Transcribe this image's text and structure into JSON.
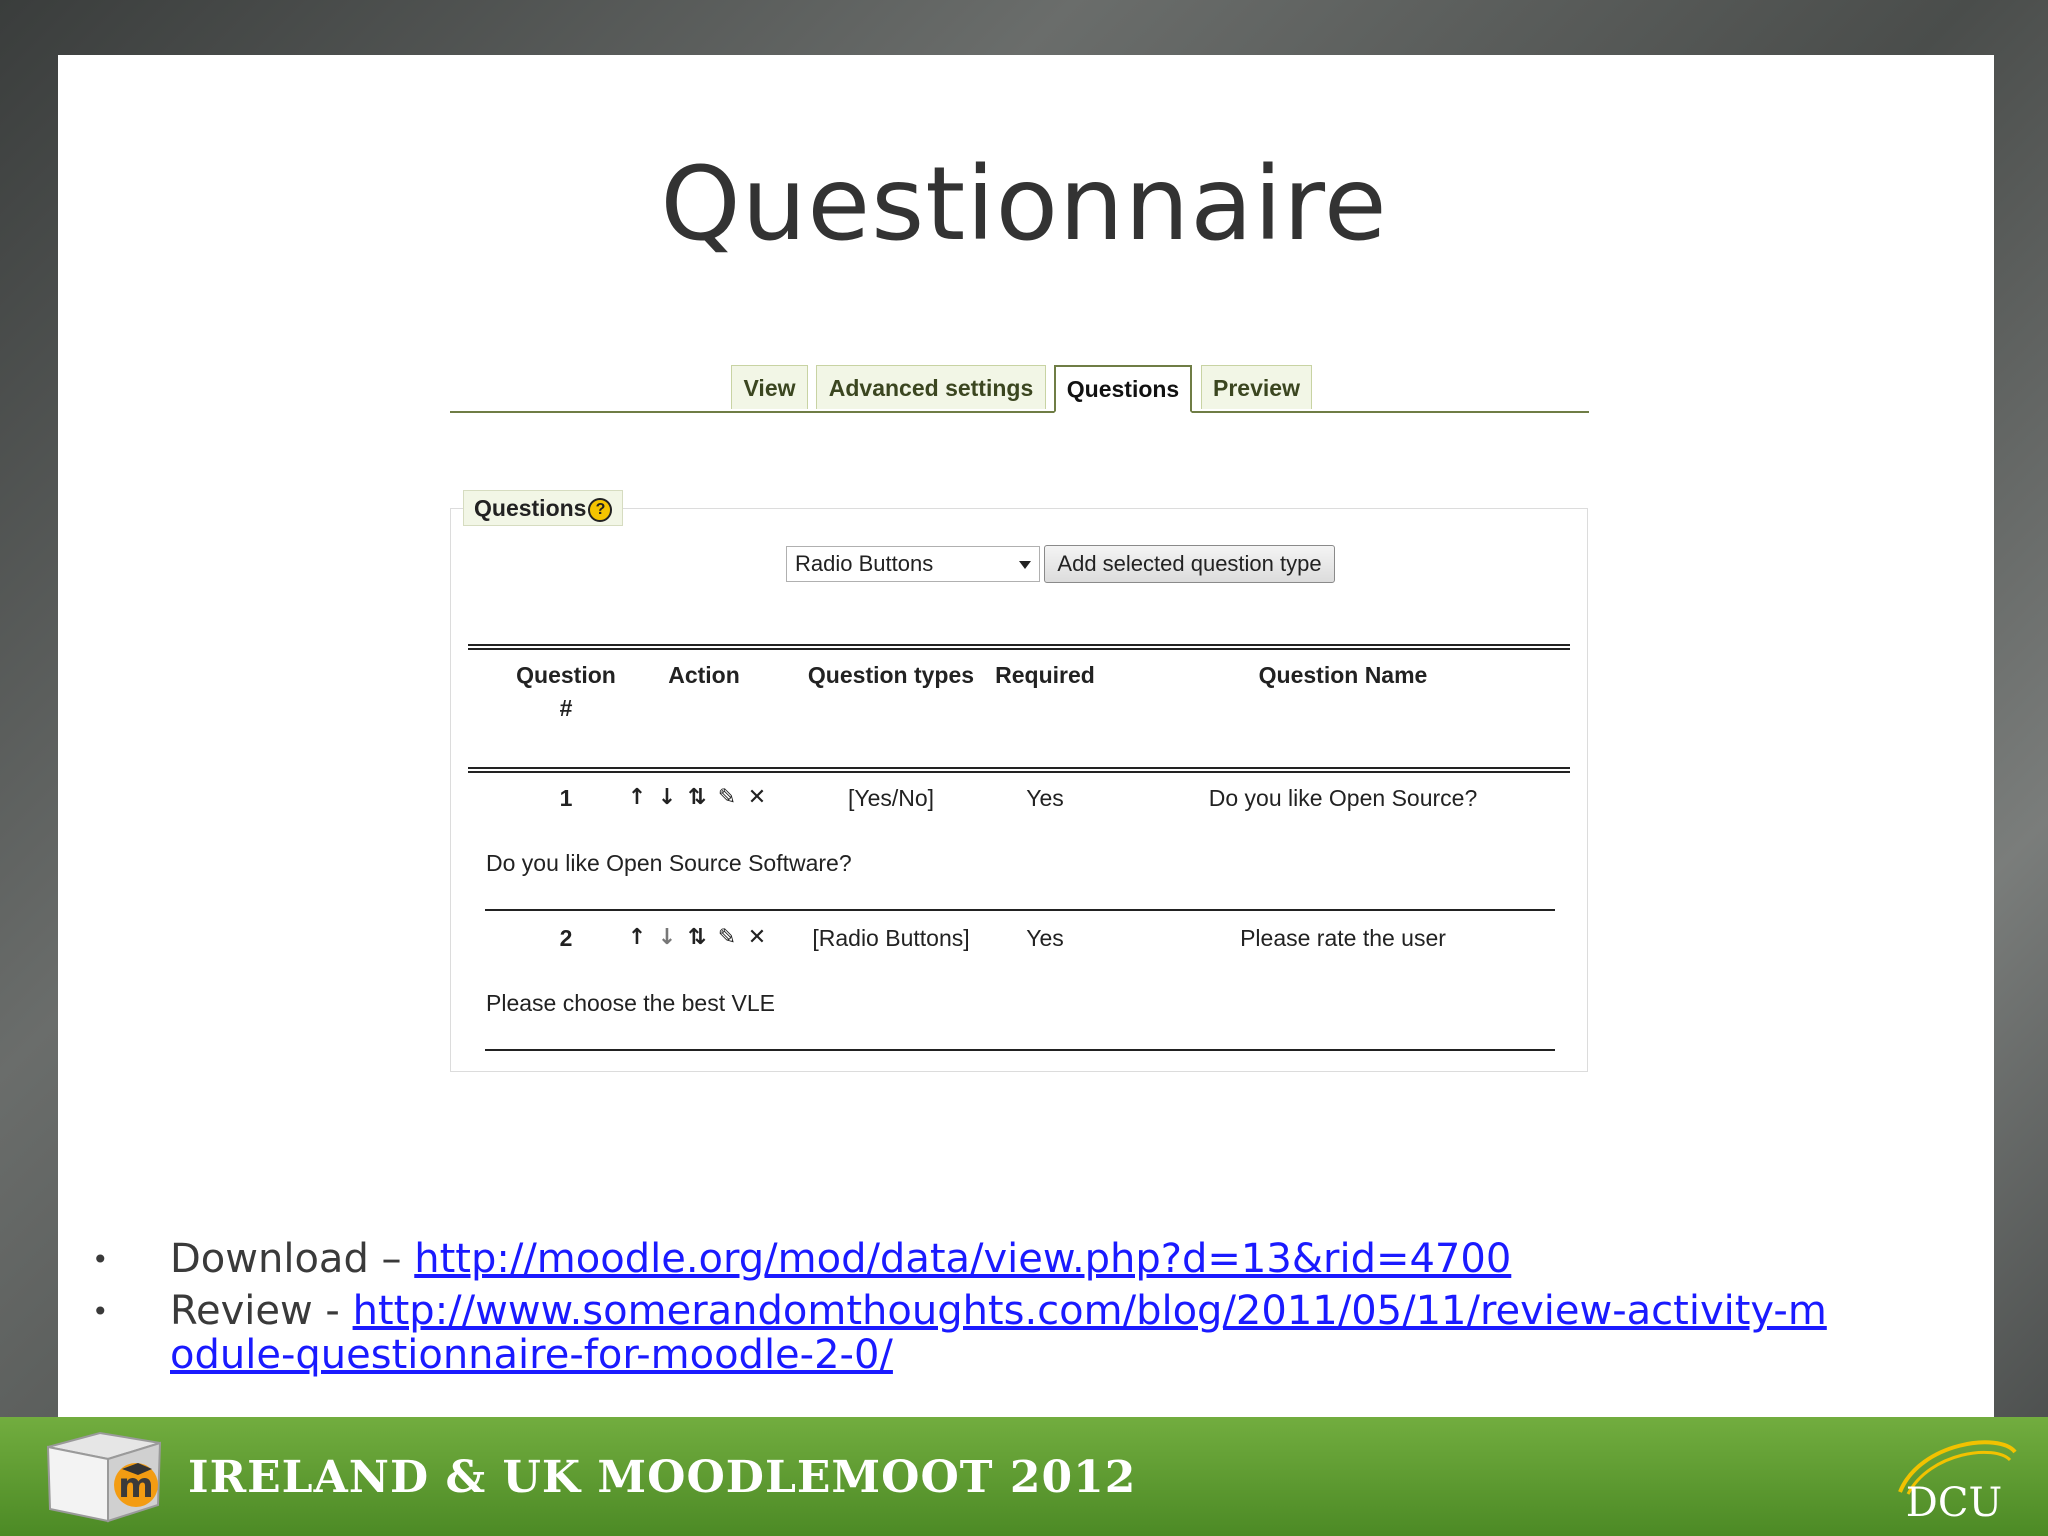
{
  "slide": {
    "title": "Questionnaire"
  },
  "tabs": [
    {
      "label": "View"
    },
    {
      "label": "Advanced settings"
    },
    {
      "label": "Questions"
    },
    {
      "label": "Preview"
    }
  ],
  "questions_panel": {
    "legend": "Questions",
    "help_glyph": "?",
    "select_value": "Radio Buttons",
    "add_button": "Add selected question type"
  },
  "table": {
    "headers": {
      "number_line1": "Question",
      "number_line2": "#",
      "action": "Action",
      "types": "Question types",
      "required": "Required",
      "name": "Question Name"
    },
    "rows": [
      {
        "number": "1",
        "type": "[Yes/No]",
        "required": "Yes",
        "name": "Do you like Open Source?",
        "text": "Do you like Open Source Software?"
      },
      {
        "number": "2",
        "type": "[Radio Buttons]",
        "required": "Yes",
        "name": "Please rate the user",
        "text": "Please choose the best VLE"
      }
    ],
    "action_icons": [
      "move-up-icon",
      "move-down-icon",
      "move-icon",
      "edit-icon",
      "delete-icon"
    ]
  },
  "bullets": {
    "download_prefix": "Download – ",
    "download_link": "http://moodle.org/mod/data/view.php?d=13&rid=4700",
    "review_prefix": "Review - ",
    "review_link": "http://www.somerandomthoughts.com/blog/2011/05/11/review-activity-module-questionnaire-for-moodle-2-0/"
  },
  "footer": {
    "text": "IRELAND & UK MOODLEMOOT 2012",
    "logo_left_letter": "m",
    "logo_right_text": "DCU"
  },
  "colors": {
    "footer_green": "#5f9c32",
    "tab_border": "#6f7d45",
    "link_blue": "#1a1aff"
  }
}
